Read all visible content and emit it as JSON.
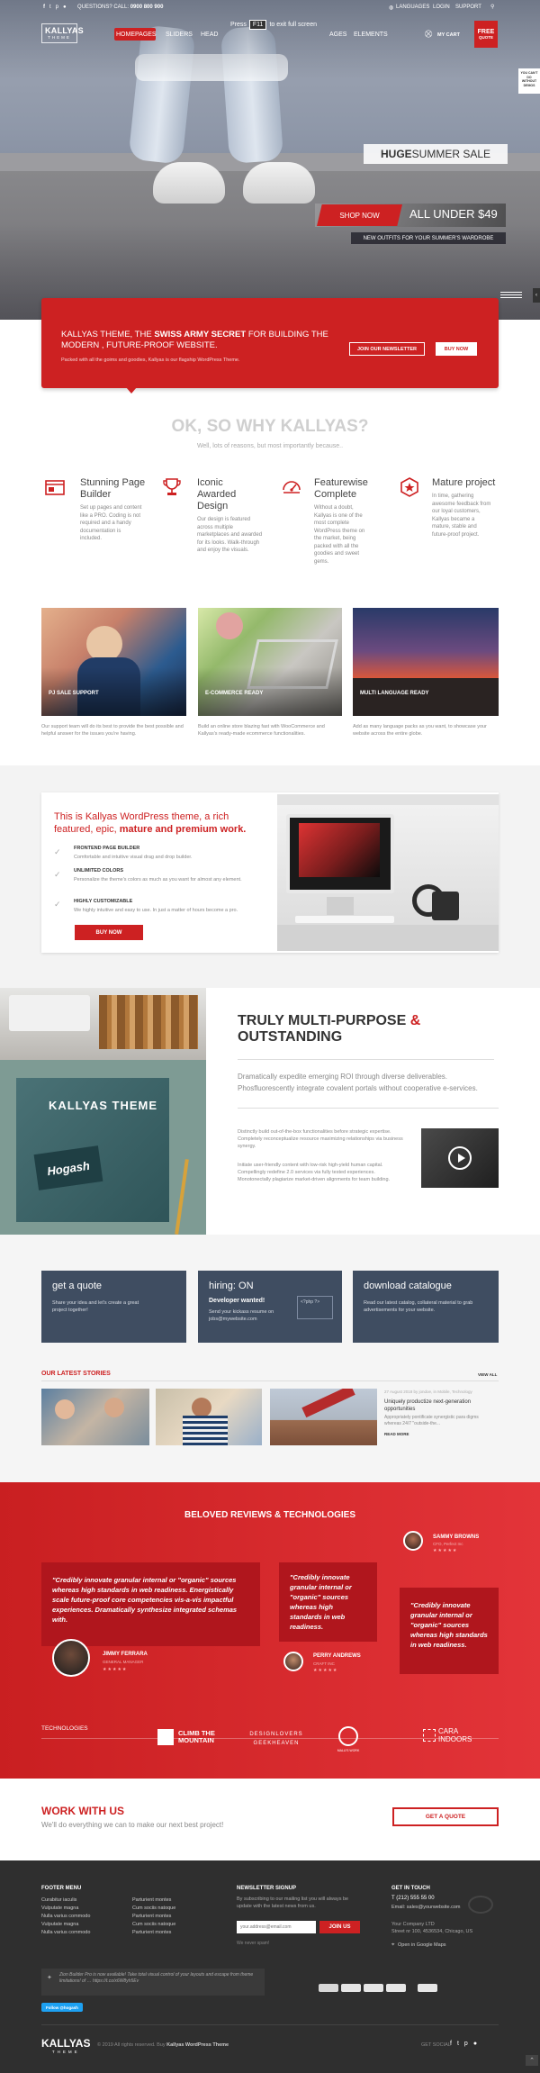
{
  "topbar": {
    "question_label": "QUESTIONS? CALL:",
    "phone": "0900 800 900",
    "languages": "LANGUAGES",
    "login": "LOGIN",
    "support": "SUPPORT",
    "fullscreen_press": "Press",
    "fullscreen_key": "F11",
    "fullscreen_msg": "to exit full screen"
  },
  "logo": {
    "brand": "KALLYAS",
    "sub": "THEME"
  },
  "nav": {
    "items": [
      "HOMEPAGES",
      "SLIDERS",
      "HEAD",
      "AGES",
      "ELEMENTS"
    ],
    "cart": "MY CART",
    "free_line1": "FREE",
    "free_line2": "QUOTE"
  },
  "side_badge": "YOU CAN'T DO WITHOUT DEMOS",
  "hero": {
    "sale_bold": "HUGE",
    "sale_rest": " SUMMER SALE",
    "shop_now": "SHOP NOW",
    "under": "ALL UNDER $49",
    "subtitle": "NEW OUTFITS FOR YOUR SUMMER'S WARDROBE"
  },
  "promo": {
    "part1": "KALLYAS THEME, THE ",
    "bold": "SWISS ARMY SECRET",
    "part2": " FOR BUILDING THE MODERN , FUTURE-PROOF WEBSITE.",
    "sub": "Packed with all the goims and goodies, Kallyas is our flagship WordPress Theme.",
    "newsletter_btn": "JOIN OUR NEWSLETTER",
    "buy_btn": "BUY NOW"
  },
  "why": {
    "title": "OK, SO WHY KALLYAS?",
    "subtitle": "Well, lots of reasons, but most importantly because..",
    "features": [
      {
        "icon": "page-builder-icon",
        "title": "Stunning Page Builder",
        "text": "Set up pages and content like a PRO. Coding is not required and a handy documentation is included."
      },
      {
        "icon": "award-icon",
        "title": "Iconic Awarded Design",
        "text": "Our design is featured across multiple marketplaces and awarded for its looks. Walk-through and enjoy the visuals."
      },
      {
        "icon": "rocket-icon",
        "title": "Featurewise Complete",
        "text": "Without a doubt, Kallyas is one of the most complete WordPress theme on the market, being packed with all the goodies and sweet gems."
      },
      {
        "icon": "star-badge-icon",
        "title": "Mature project",
        "text": "In time, gathering awesome feedback from our loyal customers, Kallyas became a mature, stable and future-proof project."
      }
    ]
  },
  "cards": [
    {
      "caption": "PJ SALE SUPPORT",
      "text": "Our support team will do its best to provide the best possible and helpful answer for the issues you're having."
    },
    {
      "caption": "E-COMMERCE READY",
      "text": "Build an online store blazing fast with WooCommerce and Kallyas's ready-made ecommerce functionalities."
    },
    {
      "caption": "MULTI LANGUAGE READY",
      "text": "Add as many language packs as you want, to showcase your website across the entire globe."
    }
  ],
  "wp": {
    "title1": "This is Kallyas WordPress theme, a rich featured, epic,",
    "title_bold": " mature and premium work.",
    "items": [
      {
        "title": "FRONTEND PAGE BUILDER",
        "text": "Comfortable and intuitive visual drag and drop builder."
      },
      {
        "title": "UNLIMITED COLORS",
        "text": "Personalize the theme's colors as much as you want for almost any element."
      },
      {
        "title": "HIGHLY CUSTOMIZABLE",
        "text": "We highly intuitive and easy to use. In just a matter of hours become a pro."
      }
    ],
    "buy": "BUY NOW"
  },
  "multi": {
    "title1": "TRULY MULTI-PURPOSE ",
    "amp": "&",
    "title2": "OUTSTANDING",
    "lead": "Dramatically expedite emerging ROI through diverse deliverables. Phosfluorescently integrate covalent portals without cooperative e-services.",
    "p1": "Distinctly build out-of-the-box functionalities before strategic expertise. Completely reconceptualize resource maximizing relationships via business synergy.",
    "p2": "Initiate user-friendly content with low-risk high-yield human capital. Compellingly redefine 2.0 services via fully tested experiences. Monotonectally plagiarize market-driven alignments for team building.",
    "notebook_text": "KALLYAS THEME",
    "hogash": "Hogash"
  },
  "boxes": [
    {
      "title": "get a quote",
      "text": "Share your idea and let's create a great project together!"
    },
    {
      "title": "hiring: ON",
      "bold": "Developer wanted!",
      "text": "Send your kickass resume on jobs@mywebsite.com"
    },
    {
      "title": "download catalogue",
      "text": "Read our latest catalog, collateral material to grab advertisements for your website."
    }
  ],
  "stories": {
    "title": "OUR LATEST STORIES",
    "view_all": "VIEW ALL",
    "meta": "27 August 2018 by jondoe, in Mobile, Technology",
    "headline": "Uniquely productize next-generation opportunities",
    "excerpt": "Appropriately pontificate synergistic para digms whereas 24/7 \"outside-the...",
    "read_more": "READ MORE"
  },
  "reviews": {
    "title": "BELOVED REVIEWS & TECHNOLOGIES",
    "items": [
      {
        "quote": "\"Credibly innovate granular internal or \"organic\" sources whereas high standards in web readiness. Energistically scale future-proof core competencies vis-a-vis impactful experiences. Dramatically synthesize integrated schemas with.",
        "name": "JIMMY FERRARA",
        "role": "GENERAL MANAGER"
      },
      {
        "quote": "\"Credibly innovate granular internal or \"organic\" sources whereas high standards in web readiness.",
        "name": "PERRY ANDREWS",
        "role": "CRAFT INC"
      },
      {
        "quote": "\"Credibly innovate granular internal or \"organic\" sources whereas high standards in web readiness.",
        "name": "SAMMY BROWNS",
        "role": "CFO, Perfect Inc"
      }
    ],
    "tech_label": "TECHNOLOGIES",
    "logos": [
      "CLIMB THE MOUNTAIN",
      "DESIGNLOVERS GEEKHEAVEN",
      "MALU'S WORK",
      "CARA INDOORS"
    ]
  },
  "work": {
    "title": "WORK WITH US",
    "sub": "We'll do everything we can to make our next best project!",
    "btn": "GET A QUOTE"
  },
  "footer": {
    "menu_title": "FOOTER MENU",
    "menu_col1": [
      "Curabitur iaculis",
      "Vulputate magna",
      "Nulla varius commodo",
      "Vulputate magna",
      "Nulla varius commodo"
    ],
    "menu_col2": [
      "Parturient montes",
      "Cum sociis natoque",
      "Parturient montes",
      "Cum sociis natoque",
      "Parturient montes"
    ],
    "newsletter_title": "NEWSLETTER SIGNUP",
    "newsletter_text": "By subscribing to our mailing list you will always be update with the latest news from us.",
    "email_placeholder": "your.address@email.com",
    "join_btn": "JOIN US",
    "never_spam": "We never spam!",
    "touch_title": "GET IN TOUCH",
    "phone": "T (212) 555 55 00",
    "email": "Email: sales@yourwebsite.com",
    "company": "Your Company LTD",
    "street": "Street nr 100, 4536534, Chicago, US",
    "maps": "Open in Google Maps",
    "tweet": "Zion Builder Pro is now available! Take total visual control of your layouts and escape from theme limitations! of … https://t.co/x6W8yh5Ev",
    "follow": "Follow @hogash",
    "copyright": "© 2019 All rights reserved. Buy",
    "copyright_link": "Kallyas WordPress Theme",
    "get_social": "GET SOCIAL"
  }
}
